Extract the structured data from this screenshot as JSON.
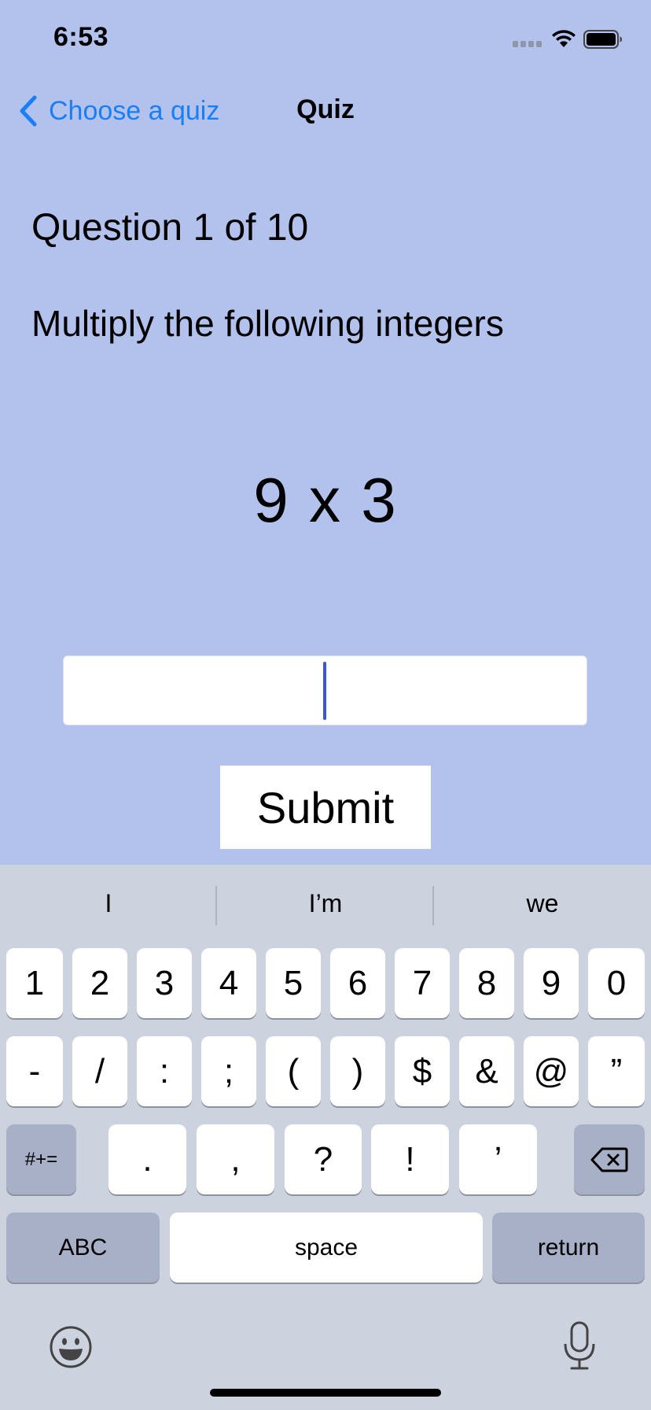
{
  "status_bar": {
    "time": "6:53"
  },
  "nav": {
    "back_label": "Choose a quiz",
    "title": "Quiz"
  },
  "quiz": {
    "question_count": "Question 1 of 10",
    "instruction": "Multiply the following integers",
    "problem": "9 x 3",
    "answer_value": "",
    "submit_label": "Submit"
  },
  "keyboard": {
    "predictions": [
      "I",
      "I’m",
      "we"
    ],
    "row1": [
      "1",
      "2",
      "3",
      "4",
      "5",
      "6",
      "7",
      "8",
      "9",
      "0"
    ],
    "row2": [
      "-",
      "/",
      ":",
      ";",
      "(",
      ")",
      "$",
      "&",
      "@",
      "”"
    ],
    "row3": {
      "symbols_toggle": "#+=",
      "keys": [
        ".",
        ",",
        "?",
        "!",
        "’"
      ]
    },
    "row4": {
      "abc": "ABC",
      "space": "space",
      "return": "return"
    }
  }
}
